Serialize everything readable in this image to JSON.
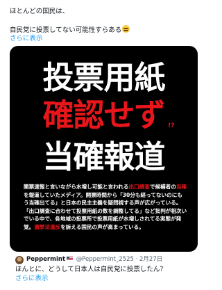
{
  "post": {
    "line1": "ほとんどの国民は、",
    "line2": "自民党に投票してない可能性すらある",
    "emoji": "relieved-face-emoji",
    "more": "さらに表示"
  },
  "image": {
    "headline1": "投票用紙",
    "headline2": "確認せず",
    "qmark": "!?",
    "headline3": "当確報道",
    "body": [
      {
        "t": "開票速報と言いながら水増し可能と言われる",
        "hl": false
      },
      {
        "t": "出口調査",
        "hl": true
      },
      {
        "t": "で候補者の",
        "hl": false
      },
      {
        "t": "当確",
        "hl": true
      },
      {
        "t": "を報道していたメディア。開票時間から「30分も経ってないのにもう当確出てる」と日本の民主主義を疑問視する声が広がっている。「出口調査に合わせて投票用紙の数を調整してる」など批判が相次いでいる中で、各地域の投票所で投票用紙が水増しされてる実態が発覚。",
        "hl": false
      },
      {
        "t": "選挙法違反",
        "hl": true
      },
      {
        "t": "を訴える国民の声が高まっている。",
        "hl": false
      }
    ]
  },
  "quote": {
    "name": "Peppermint",
    "flag": "us-flag-icon",
    "handle": "@Peppermint_2525",
    "sep": "·",
    "date": "2月27日",
    "text": "ほんとに、どうして日本人は自民党に投票したん？",
    "more": "さらに表示"
  }
}
